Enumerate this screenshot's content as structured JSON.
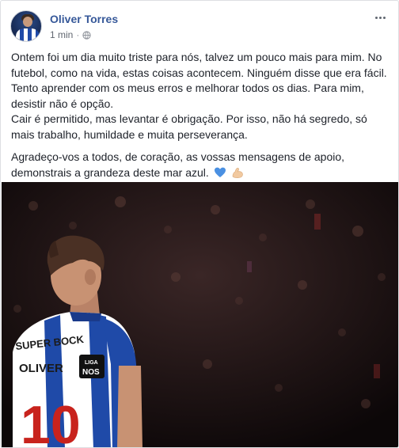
{
  "post": {
    "author": "Oliver Torres",
    "timestamp": "1 min",
    "separator": "·",
    "privacy_icon": "globe-icon",
    "more_icon": "more-options-icon",
    "paragraphs": [
      "Ontem foi um dia muito triste para nós, talvez um pouco mais para mim. No futebol, como na vida, estas coisas acontecem. Ninguém disse que era fácil. Tento aprender com os meus erros e melhorar todos os dias. Para mim, desistir não é opção.",
      "Cair é permitido, mas levantar é obrigação. Por isso, não há segredo, só mais trabalho, humildade e muita perseverança.",
      "Agradeço-vos a todos, de coração, as vossas mensagens de apoio, demonstrais a grandeza deste mar azul."
    ],
    "emojis": [
      "blue-heart-icon",
      "flexed-biceps-icon"
    ]
  },
  "photo": {
    "jersey_sponsor": "SUPER BOCK",
    "jersey_name": "OLIVER",
    "jersey_number": "10",
    "badge_top": "LIGA",
    "badge_bottom": "NOS"
  },
  "colors": {
    "name_link": "#365899",
    "meta_text": "#616770",
    "jersey_blue": "#1f4aa8",
    "number_red": "#c8231d"
  }
}
